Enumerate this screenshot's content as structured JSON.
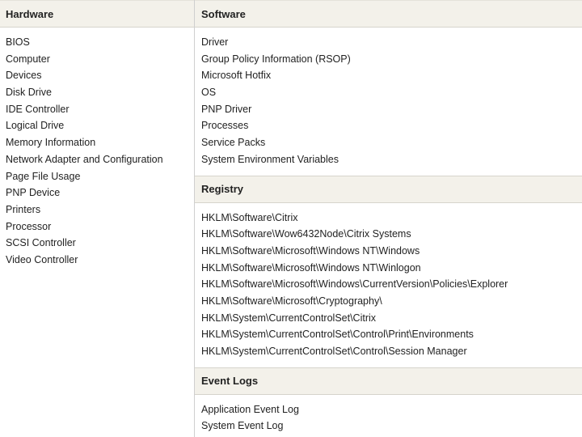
{
  "hardware": {
    "title": "Hardware",
    "items": [
      "BIOS",
      "Computer",
      "Devices",
      "Disk Drive",
      "IDE Controller",
      "Logical Drive",
      "Memory Information",
      "Network Adapter and Configuration",
      "Page File Usage",
      "PNP Device",
      "Printers",
      "Processor",
      "SCSI Controller",
      "Video Controller"
    ]
  },
  "software": {
    "title": "Software",
    "items": [
      "Driver",
      "Group Policy Information (RSOP)",
      "Microsoft Hotfix",
      "OS",
      "PNP Driver",
      "Processes",
      "Service Packs",
      "System Environment Variables"
    ]
  },
  "registry": {
    "title": "Registry",
    "items": [
      "HKLM\\Software\\Citrix",
      "HKLM\\Software\\Wow6432Node\\Citrix Systems",
      "HKLM\\Software\\Microsoft\\Windows NT\\Windows",
      "HKLM\\Software\\Microsoft\\Windows NT\\Winlogon",
      "HKLM\\Software\\Microsoft\\Windows\\CurrentVersion\\Policies\\Explorer",
      "HKLM\\Software\\Microsoft\\Cryptography\\",
      "HKLM\\System\\CurrentControlSet\\Citrix",
      "HKLM\\System\\CurrentControlSet\\Control\\Print\\Environments",
      "HKLM\\System\\CurrentControlSet\\Control\\Session Manager"
    ]
  },
  "event_logs": {
    "title": "Event Logs",
    "items": [
      "Application Event Log",
      "System Event Log"
    ]
  }
}
